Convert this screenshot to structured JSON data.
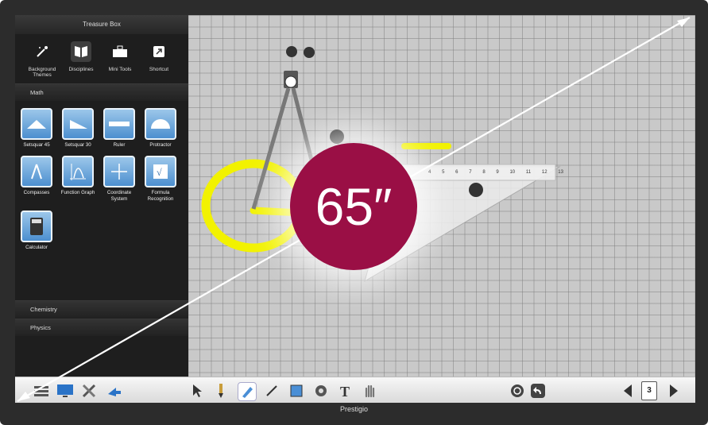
{
  "panel": {
    "title": "Treasure Box",
    "categories": [
      {
        "label": "Background\nThemes"
      },
      {
        "label": "Disciplines"
      },
      {
        "label": "Mini Tools"
      },
      {
        "label": "Shortcut"
      }
    ],
    "sections": {
      "math": "Math",
      "chemistry": "Chemistry",
      "physics": "Physics"
    },
    "tools": [
      {
        "label": "Setsquar 45"
      },
      {
        "label": "Setsquar 30"
      },
      {
        "label": "Ruler"
      },
      {
        "label": "Protractor"
      },
      {
        "label": "Compasses"
      },
      {
        "label": "Function Graph"
      },
      {
        "label": "Coordinate\nSystem"
      },
      {
        "label": "Formula\nRecognition"
      },
      {
        "label": "Calculator"
      }
    ]
  },
  "canvas": {
    "ruler_ticks": [
      "4",
      "5",
      "6",
      "7",
      "8",
      "9",
      "10",
      "11",
      "12",
      "13"
    ],
    "size_badge": "65″"
  },
  "toolbar": {
    "page_number": "3"
  },
  "device": {
    "brand": "Prestigio"
  },
  "colors": {
    "accent_badge": "#9a0f45",
    "highlight_yellow": "#f2f200"
  }
}
